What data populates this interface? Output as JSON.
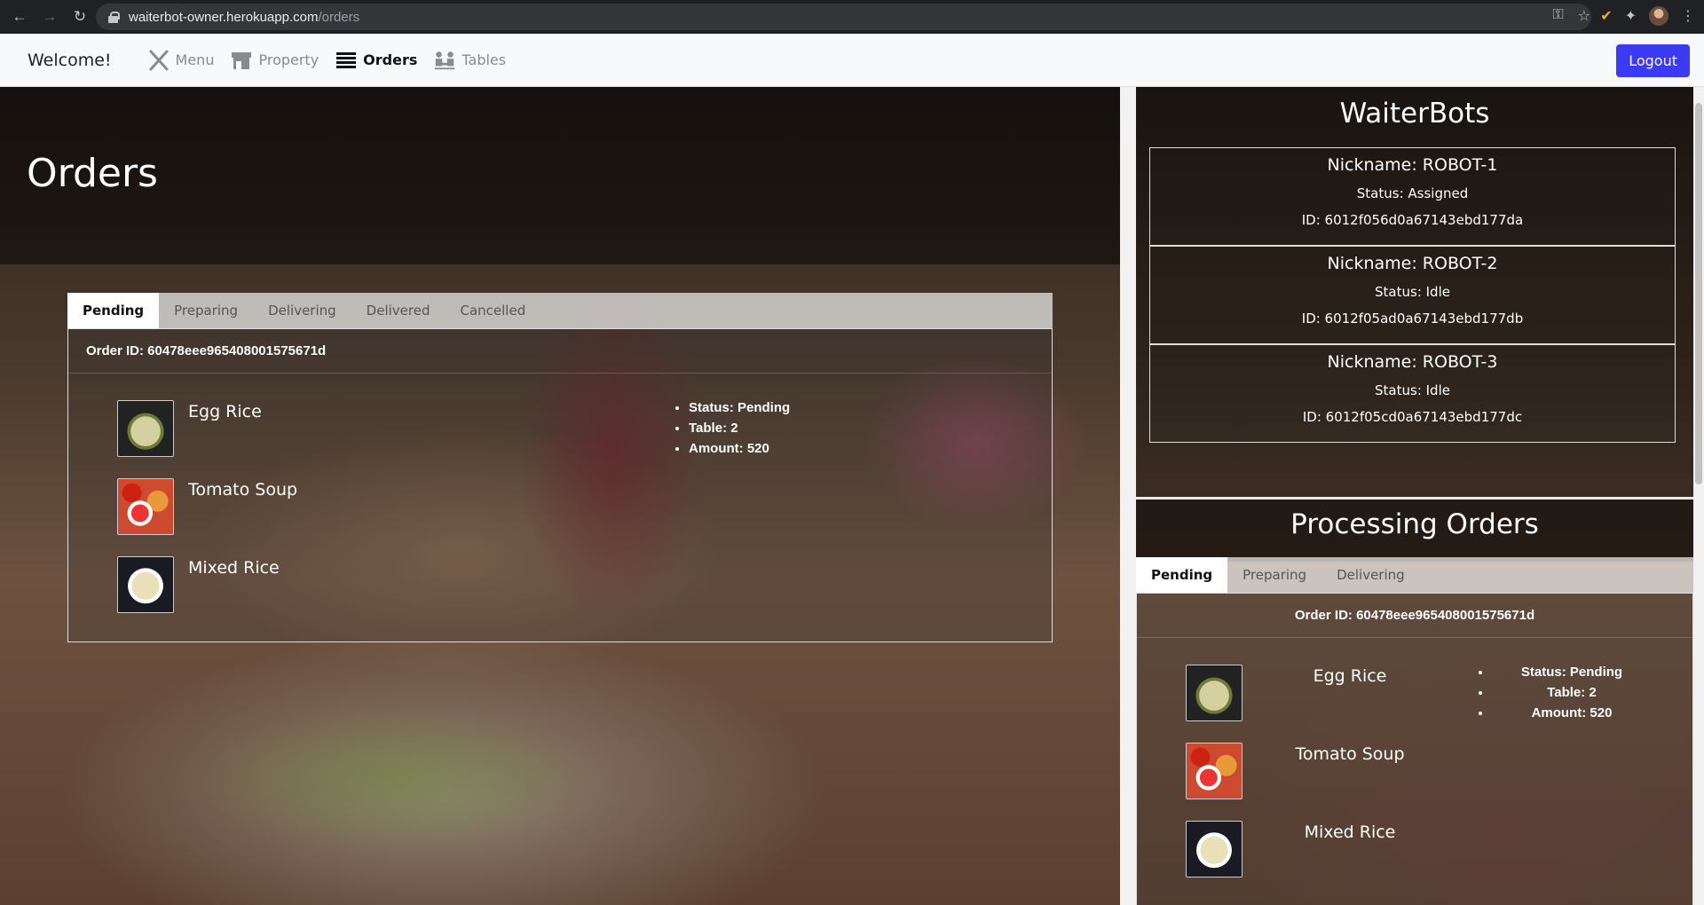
{
  "browser": {
    "url_host": "waiterbot-owner.herokuapp.com",
    "url_path": "/orders"
  },
  "nav": {
    "brand": "Welcome!",
    "links": [
      {
        "label": "Menu",
        "icon": "utensils-icon"
      },
      {
        "label": "Property",
        "icon": "store-icon"
      },
      {
        "label": "Orders",
        "icon": "list-icon",
        "active": true
      },
      {
        "label": "Tables",
        "icon": "people-table-icon"
      }
    ],
    "logout": "Logout",
    "accent": "#3b3bf5"
  },
  "orders": {
    "title": "Orders",
    "tabs": [
      "Pending",
      "Preparing",
      "Delivering",
      "Delivered",
      "Cancelled"
    ],
    "active_tab": "Pending",
    "order": {
      "id_text": "Order ID: 60478eee965408001575671d",
      "items": [
        "Egg Rice",
        "Tomato Soup",
        "Mixed Rice"
      ],
      "status": "Status: Pending",
      "table": "Table: 2",
      "amount": "Amount: 520"
    }
  },
  "waiterbots": {
    "title": "WaiterBots",
    "bots": [
      {
        "nick": "Nickname: ROBOT-1",
        "status": "Status: Assigned",
        "id": "ID: 6012f056d0a67143ebd177da"
      },
      {
        "nick": "Nickname: ROBOT-2",
        "status": "Status: Idle",
        "id": "ID: 6012f05ad0a67143ebd177db"
      },
      {
        "nick": "Nickname: ROBOT-3",
        "status": "Status: Idle",
        "id": "ID: 6012f05cd0a67143ebd177dc"
      }
    ]
  },
  "processing": {
    "title": "Processing Orders",
    "tabs": [
      "Pending",
      "Preparing",
      "Delivering"
    ],
    "active_tab": "Pending",
    "order": {
      "id_text": "Order ID: 60478eee965408001575671d",
      "items": [
        "Egg Rice",
        "Tomato Soup",
        "Mixed Rice"
      ],
      "status": "Status: Pending",
      "table": "Table: 2",
      "amount": "Amount: 520"
    }
  }
}
